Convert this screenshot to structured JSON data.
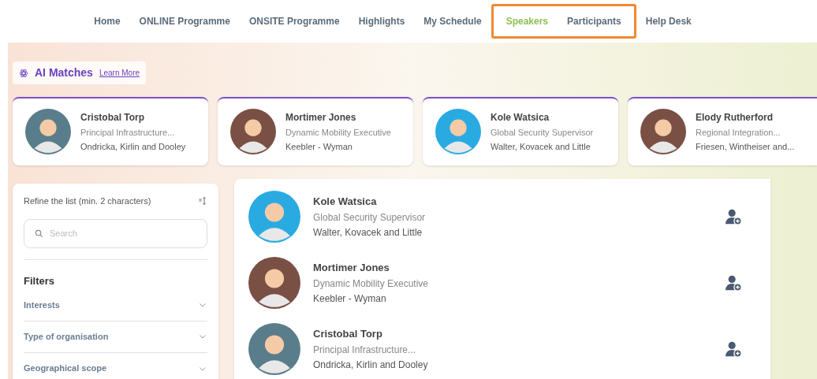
{
  "nav": [
    {
      "label": "Home",
      "selected": false,
      "highlighted": false
    },
    {
      "label": "ONLINE Programme",
      "selected": false,
      "highlighted": false
    },
    {
      "label": "ONSITE Programme",
      "selected": false,
      "highlighted": false
    },
    {
      "label": "Highlights",
      "selected": false,
      "highlighted": false
    },
    {
      "label": "My Schedule",
      "selected": false,
      "highlighted": false
    },
    {
      "label": "Speakers",
      "selected": true,
      "highlighted": true
    },
    {
      "label": "Participants",
      "selected": false,
      "highlighted": true
    },
    {
      "label": "Help Desk",
      "selected": false,
      "highlighted": false
    }
  ],
  "ai_matches": {
    "title": "AI Matches",
    "link": "Learn More",
    "cards": [
      {
        "name": "Cristobal Torp",
        "role": "Principal Infrastructure...",
        "company": "Ondricka, Kirlin and Dooley",
        "color": "#5a7d8c"
      },
      {
        "name": "Mortimer Jones",
        "role": "Dynamic Mobility Executive",
        "company": "Keebler - Wyman",
        "color": "#7a5044"
      },
      {
        "name": "Kole Watsica",
        "role": "Global Security Supervisor",
        "company": "Walter, Kovacek and Little",
        "color": "#29abe2"
      },
      {
        "name": "Elody Rutherford",
        "role": "Regional Integration...",
        "company": "Friesen, Wintheiser and...",
        "color": "#7a5044"
      }
    ]
  },
  "sidebar": {
    "refine_label": "Refine the list (min. 2 characters)",
    "search": {
      "placeholder": "Search"
    },
    "filters_title": "Filters",
    "filters": [
      {
        "label": "Interests",
        "expanded": false
      },
      {
        "label": "Type of organisation",
        "expanded": false
      },
      {
        "label": "Geographical scope",
        "expanded": false
      }
    ]
  },
  "list": [
    {
      "name": "Kole Watsica",
      "role": "Global Security Supervisor",
      "company": "Walter, Kovacek and Little",
      "color": "#29abe2"
    },
    {
      "name": "Mortimer Jones",
      "role": "Dynamic Mobility Executive",
      "company": "Keebler - Wyman",
      "color": "#7a5044"
    },
    {
      "name": "Cristobal Torp",
      "role": "Principal Infrastructure...",
      "company": "Ondricka, Kirlin and Dooley",
      "color": "#5a7d8c"
    }
  ]
}
